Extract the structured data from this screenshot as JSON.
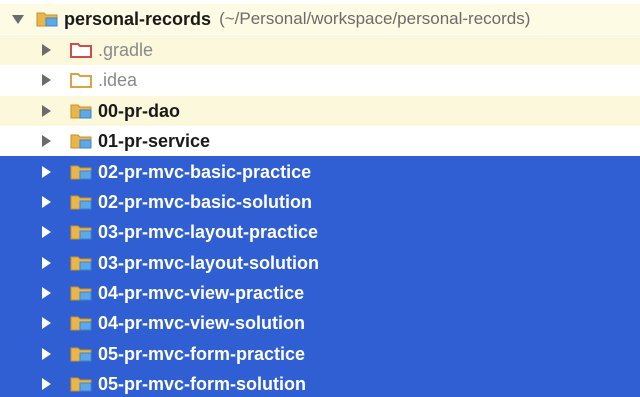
{
  "root": {
    "name": "personal-records",
    "path": "(~/Personal/workspace/personal-records)"
  },
  "items": [
    {
      "label": ".gradle",
      "style": "muted",
      "icon": "folder-red-icon"
    },
    {
      "label": ".idea",
      "style": "muted",
      "icon": "folder-plain-icon"
    },
    {
      "label": "00-pr-dao",
      "style": "bold",
      "icon": "module-folder-icon"
    },
    {
      "label": "01-pr-service",
      "style": "bold",
      "icon": "module-folder-icon"
    },
    {
      "label": "02-pr-mvc-basic-practice",
      "style": "selected",
      "icon": "module-folder-icon"
    },
    {
      "label": "02-pr-mvc-basic-solution",
      "style": "selected",
      "icon": "module-folder-icon"
    },
    {
      "label": "03-pr-mvc-layout-practice",
      "style": "selected",
      "icon": "module-folder-icon"
    },
    {
      "label": "03-pr-mvc-layout-solution",
      "style": "selected",
      "icon": "module-folder-icon"
    },
    {
      "label": "04-pr-mvc-view-practice",
      "style": "selected",
      "icon": "module-folder-icon"
    },
    {
      "label": "04-pr-mvc-view-solution",
      "style": "selected",
      "icon": "module-folder-icon"
    },
    {
      "label": "05-pr-mvc-form-practice",
      "style": "selected",
      "icon": "module-folder-icon"
    },
    {
      "label": "05-pr-mvc-form-solution",
      "style": "selected",
      "icon": "module-folder-icon"
    }
  ],
  "colors": {
    "selection": "#2f5fd2",
    "root_band": "#fdfbe3",
    "folder_orange": "#d9a441",
    "folder_blue": "#5fa8e8",
    "folder_red": "#d24a4a"
  }
}
